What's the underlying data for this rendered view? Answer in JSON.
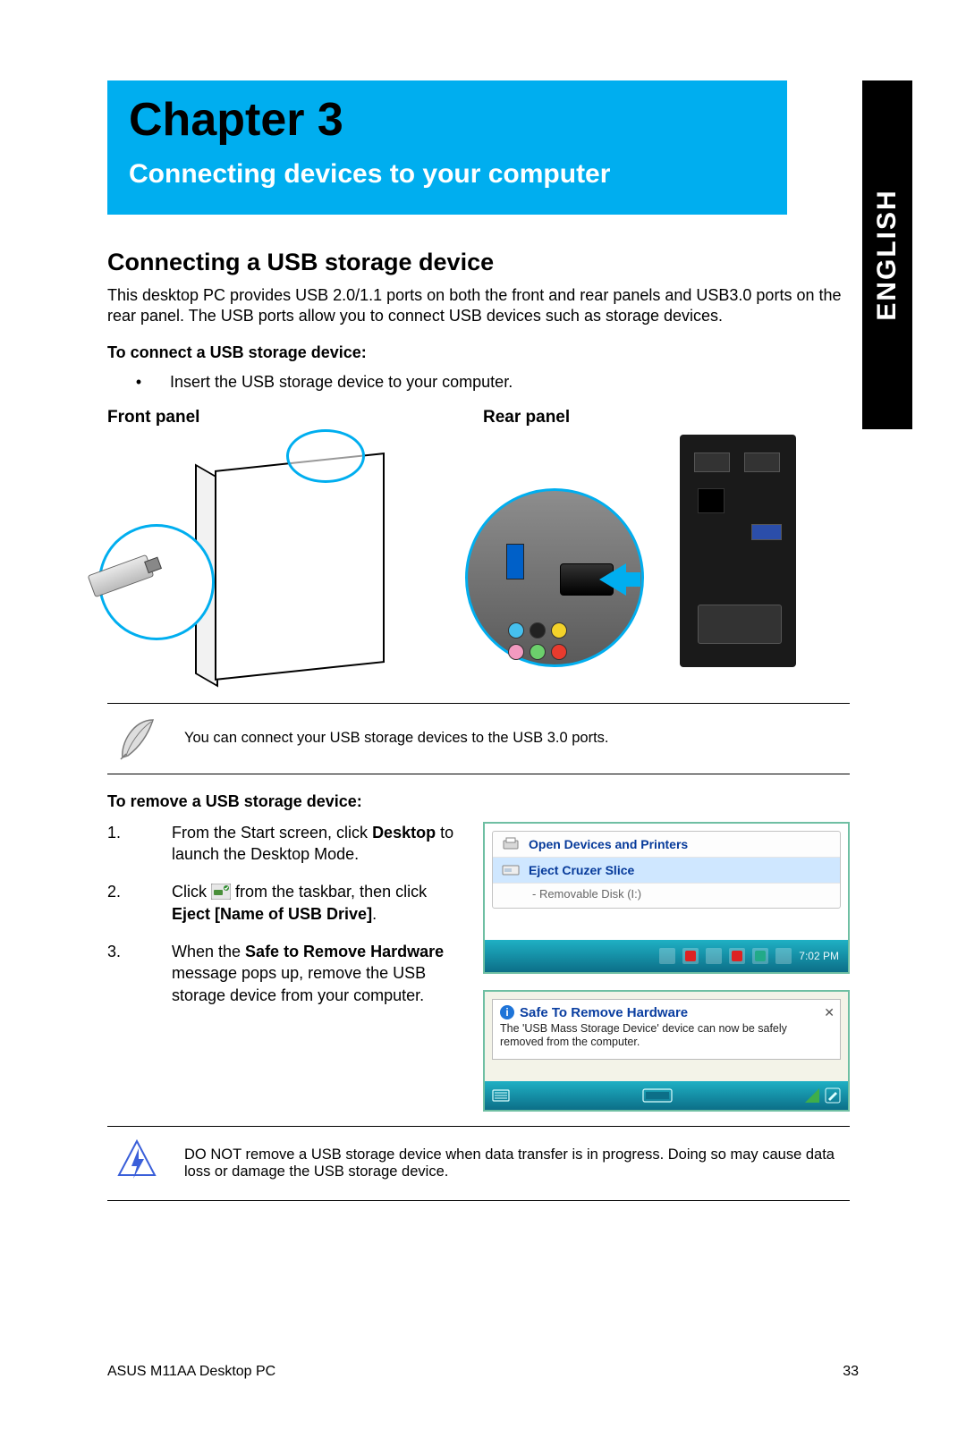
{
  "banner": {
    "chapter": "Chapter 3",
    "subtitle": "Connecting devices to your computer"
  },
  "language_tab": "ENGLISH",
  "section_title": "Connecting a USB storage device",
  "intro_paragraph": "This desktop PC provides USB 2.0/1.1 ports on both the front and rear panels and USB3.0 ports on the rear panel. The USB ports allow you to connect USB devices such as storage devices.",
  "connect_heading": "To connect a USB storage device:",
  "connect_bullet": "Insert the USB storage device to your computer.",
  "front_panel_label": "Front panel",
  "rear_panel_label": "Rear panel",
  "note_text": "You can connect your USB storage devices to the USB 3.0 ports.",
  "remove_heading": "To remove a USB storage device:",
  "steps": {
    "s1_pre": "From the Start screen, click ",
    "s1_bold": "Desktop",
    "s1_post": " to launch the Desktop Mode.",
    "s2_pre": "Click ",
    "s2_mid": " from the taskbar, then click ",
    "s2_bold1": "Eject [Name of USB Drive]",
    "s2_post": ".",
    "s3_pre": "When the ",
    "s3_bold": "Safe to Remove Hardware",
    "s3_post": " message pops up, remove the USB storage device from your computer."
  },
  "screenshots": {
    "menu1": "Open Devices and Printers",
    "menu2": "Eject Cruzer Slice",
    "menu2sub": "-   Removable Disk (I:)",
    "taskbar_time": "7:02 PM",
    "tooltip_title": "Safe To Remove Hardware",
    "tooltip_body": "The 'USB Mass Storage Device' device can now be safely removed from the computer."
  },
  "warning_text": "DO NOT remove a USB storage device when data transfer is in progress. Doing so may cause data loss or damage the USB storage device.",
  "footer": {
    "left": "ASUS M11AA Desktop PC",
    "right": "33"
  }
}
